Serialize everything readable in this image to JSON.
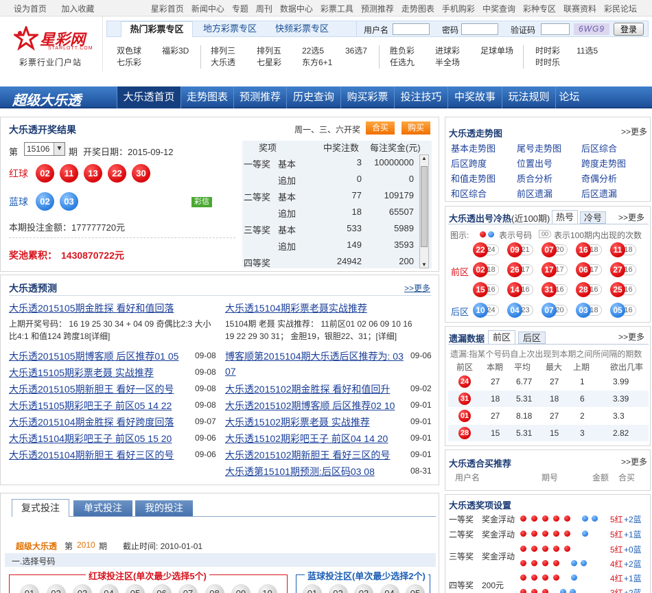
{
  "topbar": {
    "left": [
      "设为首页",
      "加入收藏"
    ],
    "right": [
      "星彩首页",
      "新闻中心",
      "专题",
      "周刊",
      "数据中心",
      "彩票工具",
      "预测推荐",
      "走势图表",
      "手机购彩",
      "中奖查询",
      "彩种专区",
      "联赛资料",
      "彩民论坛"
    ]
  },
  "logo": {
    "name": "星彩网",
    "sub": "STARLOTT.COM",
    "slogan": "彩票行业门户站"
  },
  "zones": [
    "热门彩票专区",
    "地方彩票专区",
    "快频彩票专区"
  ],
  "login": {
    "user": "用户名",
    "pass": "密码",
    "code": "验证码",
    "captcha": "6WG9",
    "button": "登录"
  },
  "games": {
    "g1": [
      "双色球",
      "福彩3D",
      "七乐彩"
    ],
    "g2": [
      "排列三",
      "排列五",
      "22选5",
      "36选7",
      "大乐透",
      "七星彩",
      "东方6+1"
    ],
    "g3": [
      "胜负彩",
      "进球彩",
      "足球单场",
      "任选九",
      "半全场"
    ],
    "g4": [
      "时时彩",
      "11选5",
      "时时乐"
    ]
  },
  "nav": {
    "brand": "超级大乐透",
    "items": [
      "大乐透首页",
      "走势图表",
      "预测推荐",
      "历史查询",
      "购买彩票",
      "投注技巧",
      "中奖故事",
      "玩法规则",
      "论坛"
    ]
  },
  "result": {
    "title": "大乐透开奖结果",
    "schedule": "周一、三、六开奖",
    "btn_hemai": "合买",
    "btn_buy": "购买",
    "issue_prefix": "第",
    "issue": "15106",
    "issue_suffix": "期",
    "date_label": "开奖日期：2015-09-12",
    "red_label": "红球",
    "red": [
      "02",
      "11",
      "13",
      "22",
      "30"
    ],
    "blue_label": "蓝球",
    "blue": [
      "02",
      "03"
    ],
    "caixin": "彩信",
    "total": "本期投注金额：177777720元",
    "pool_label": "奖池累积：",
    "pool": "1430870722元",
    "table_head": [
      "奖项",
      "中奖注数",
      "每注奖金(元)"
    ],
    "rows": [
      {
        "a": "一等奖",
        "b": "基本",
        "c": "3",
        "d": "10000000"
      },
      {
        "a": "",
        "b": "追加",
        "c": "0",
        "d": "0"
      },
      {
        "a": "二等奖",
        "b": "基本",
        "c": "77",
        "d": "109179"
      },
      {
        "a": "",
        "b": "追加",
        "c": "18",
        "d": "65507"
      },
      {
        "a": "三等奖",
        "b": "基本",
        "c": "533",
        "d": "5989"
      },
      {
        "a": "",
        "b": "追加",
        "c": "149",
        "d": "3593"
      },
      {
        "a": "四等奖",
        "b": "",
        "c": "24942",
        "d": "200"
      }
    ]
  },
  "predict": {
    "title": "大乐透预测",
    "more": ">>更多",
    "left_head": "大乐透2015105期金胜探  看好和值回落",
    "left_text1": "上期开奖号码：  16 19 25 30 34 + 04 09 奇偶比2:3 大小",
    "left_text2": "比4:1 和值124 跨度18[详细]",
    "right_head": "大乐透15104期彩票老聂实战推荐",
    "right_text1": "15104期  老聂  实战推荐：  11前区01 02 06 09 10 16",
    "right_text2": "19 22 29 30 31；  金胆19，银胆22、31；[详细]",
    "left_list": [
      {
        "t": "大乐透2015105期博客顺  后区推荐01 05",
        "d": "09-08"
      },
      {
        "t": "大乐透15105期彩票老聂  实战推荐",
        "d": "09-08"
      },
      {
        "t": "大乐透2015105期新胆王  看好一区的号",
        "d": "09-08"
      },
      {
        "t": "大乐透15105期彩吧王子  前区05 14 22",
        "d": "09-08"
      },
      {
        "t": "大乐透2015104期金胜探  看好跨度回落",
        "d": "09-07"
      },
      {
        "t": "大乐透15104期彩吧王子  前区05 15 20",
        "d": "09-06"
      },
      {
        "t": "大乐透2015104期新胆王  看好三区的号",
        "d": "09-06"
      }
    ],
    "right_list": [
      {
        "t": "博客顺第2015104期大乐透后区推荐为: 03",
        "t2": "07",
        "d": "09-06"
      },
      {
        "t": "大乐透2015102期金胜探  看好和值回升",
        "d": "09-02"
      },
      {
        "t": "大乐透2015102期博客顺  后区推荐02 10",
        "d": "09-01"
      },
      {
        "t": "大乐透15102期彩票老聂  实战推荐",
        "d": "09-01"
      },
      {
        "t": "大乐透15102期彩吧王子  前区04 14 20",
        "d": "09-01"
      },
      {
        "t": "大乐透2015102期新胆王  看好三区的号",
        "d": "09-01"
      },
      {
        "t": "大乐透第15101期预测:后区码03 08",
        "d": "08-31"
      }
    ]
  },
  "bet": {
    "tabs": [
      "复式投注",
      "单式投注",
      "我的投注"
    ],
    "game": "超级大乐透",
    "issue_pre": "第",
    "issue": "2010",
    "issue_suf": "期",
    "deadline": "截止时间:  2010-01-01",
    "step": "一.选择号码",
    "red_zone": "红球投注区(单次最少选择5个)",
    "blue_zone": "蓝球投注区(单次最少选择2个)",
    "red_nums": [
      "01",
      "02",
      "03",
      "04",
      "05",
      "06",
      "07",
      "08",
      "09",
      "10"
    ],
    "blue_nums": [
      "01",
      "02",
      "03",
      "04",
      "05"
    ]
  },
  "trend": {
    "title": "大乐透走势图",
    "more": ">>更多",
    "links": [
      "基本走势图",
      "尾号走势图",
      "后区综合",
      "后区跨度",
      "位置出号",
      "跨度走势图",
      "和值走势图",
      "质合分析",
      "奇偶分析",
      "和区综合",
      "前区遗漏",
      "后区遗漏"
    ]
  },
  "hotcold": {
    "title": "大乐透出号冷热",
    "title_sub": "(近100期)",
    "tab_hot": "热号",
    "tab_cold": "冷号",
    "more": ">>更多",
    "legend_pre": "图示:",
    "legend_num": "表示号码",
    "legend_cnt": "00",
    "legend_post": "表示100期内出现的次数",
    "front_label": "前区",
    "back_label": "后区",
    "front": [
      {
        "n": "22",
        "c": "24"
      },
      {
        "n": "09",
        "c": "21"
      },
      {
        "n": "07",
        "c": "20"
      },
      {
        "n": "16",
        "c": "18"
      },
      {
        "n": "11",
        "c": "18"
      },
      {
        "n": "02",
        "c": "18"
      },
      {
        "n": "26",
        "c": "17"
      },
      {
        "n": "17",
        "c": "17"
      },
      {
        "n": "06",
        "c": "17"
      },
      {
        "n": "27",
        "c": "16"
      },
      {
        "n": "15",
        "c": "16"
      },
      {
        "n": "14",
        "c": "16"
      },
      {
        "n": "31",
        "c": "16"
      },
      {
        "n": "28",
        "c": "16"
      },
      {
        "n": "25",
        "c": "16"
      }
    ],
    "back": [
      {
        "n": "10",
        "c": "24"
      },
      {
        "n": "04",
        "c": "23"
      },
      {
        "n": "07",
        "c": "20"
      },
      {
        "n": "03",
        "c": "18"
      },
      {
        "n": "05",
        "c": "16"
      }
    ]
  },
  "miss": {
    "title": "遗漏数据",
    "tab_front": "前区",
    "tab_back": "后区",
    "more": ">>更多",
    "note": "遗漏:指某个号码自上次出现到本期之间所间隔的期数",
    "head": [
      "前区",
      "本期",
      "平均",
      "最大",
      "上期",
      "欲出几率"
    ],
    "rows": [
      {
        "n": "24",
        "a": "27",
        "b": "6.77",
        "c": "27",
        "d": "1",
        "e": "3.99"
      },
      {
        "n": "31",
        "a": "18",
        "b": "5.31",
        "c": "18",
        "d": "6",
        "e": "3.39"
      },
      {
        "n": "01",
        "a": "27",
        "b": "8.18",
        "c": "27",
        "d": "2",
        "e": "3.3"
      },
      {
        "n": "28",
        "a": "15",
        "b": "5.31",
        "c": "15",
        "d": "3",
        "e": "2.82"
      }
    ]
  },
  "hemai": {
    "title": "大乐透合买推荐",
    "more": ">>更多",
    "head": [
      "用户名",
      "期号",
      "金额",
      "合买"
    ]
  },
  "prize": {
    "title": "大乐透奖项设置",
    "rows": [
      {
        "lvl": "一等奖",
        "amt": "奖金浮动",
        "r": 5,
        "b": 2,
        "txt1": "5红",
        "txt2": "+2蓝"
      },
      {
        "lvl": "二等奖",
        "amt": "奖金浮动",
        "r": 5,
        "b": 1,
        "txt1": "5红",
        "txt2": "+1蓝"
      },
      {
        "lvl": "三等奖",
        "amt": "奖金浮动",
        "r": 5,
        "b": 0,
        "txt1": "5红",
        "txt2": "+0蓝",
        "r2": 4,
        "b2": 2,
        "txt3": "4红",
        "txt4": "+2蓝"
      },
      {
        "lvl": "四等奖",
        "amt": "200元",
        "r": 4,
        "b": 1,
        "txt1": "4红",
        "txt2": "+1蓝",
        "r2": 3,
        "b2": 2,
        "txt3": "3红",
        "txt4": "+2蓝"
      }
    ]
  }
}
